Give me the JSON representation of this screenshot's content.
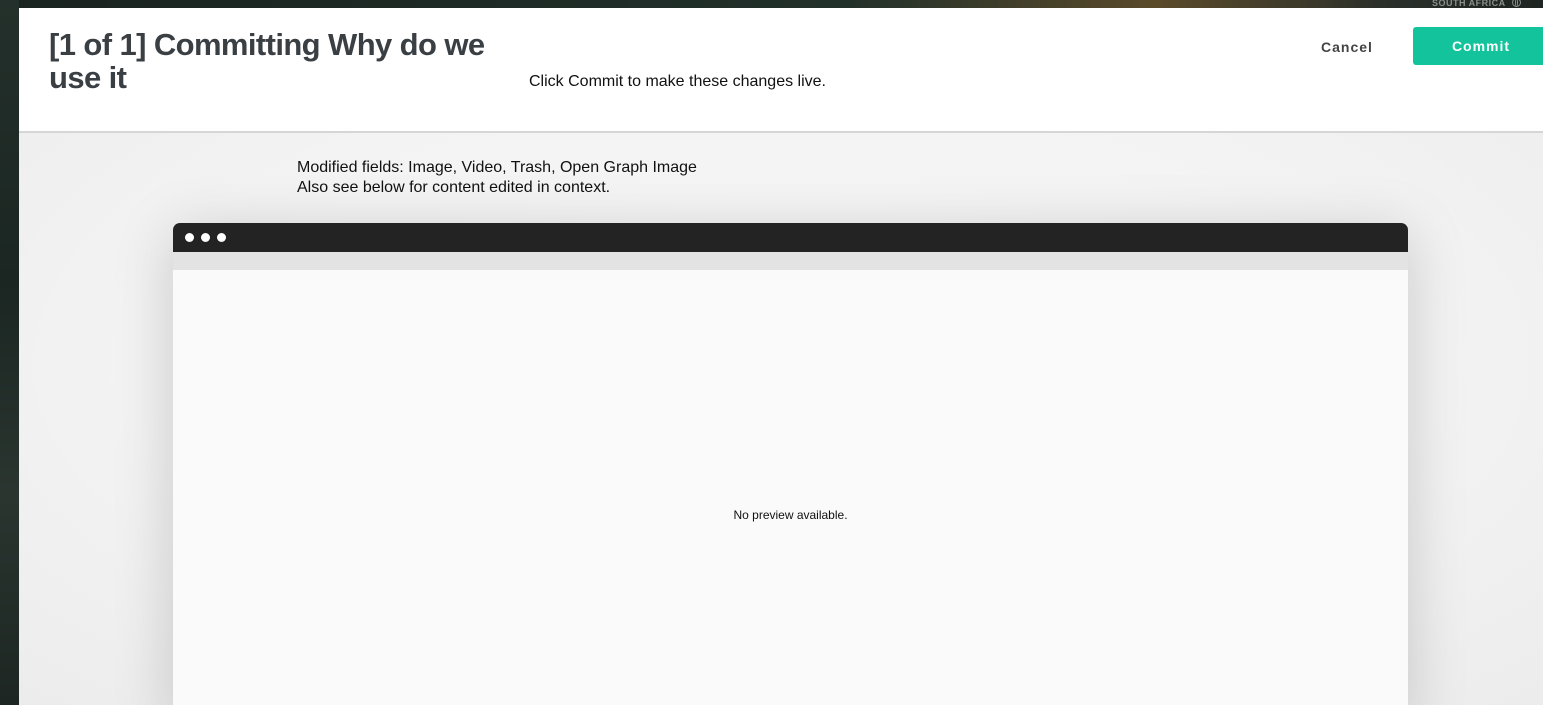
{
  "background": {
    "region_label": "South Africa",
    "region_icon": "globe-icon"
  },
  "header": {
    "title": "[1 of 1] Committing Why do we use it",
    "subtitle": "Click Commit to make these changes live.",
    "cancel_label": "Cancel",
    "commit_label": "Commit"
  },
  "body": {
    "modified_fields": "Modified fields: Image, Video, Trash, Open Graph Image",
    "context_note": "Also see below for content edited in context."
  },
  "preview": {
    "message": "No preview available."
  },
  "colors": {
    "accent": "#12c39b",
    "browser_bar": "#232323",
    "title_text": "#3a3f44"
  }
}
